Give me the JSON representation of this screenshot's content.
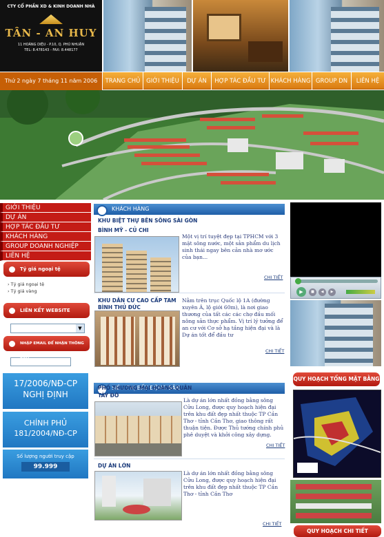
{
  "header": {
    "company_line": "CTY CỔ PHẦN XD & KINH DOANH NHÀ",
    "brand": "TÂN - AN HUY",
    "address": "11 HOÀNG DIỆU - P.10, Q. PHÚ NHUẬN",
    "phone": "TEL: 8.478143 - FAX: 8.448177"
  },
  "nav": {
    "date": "Thứ 2 ngày 7 tháng 11 năm 2006",
    "items": [
      "TRANG CHỦ",
      "GIỚI THIỆU",
      "DỰ ÁN",
      "HỢP TÁC ĐẦU TƯ",
      "KHÁCH HÀNG",
      "GROUP DN",
      "LIÊN HỆ"
    ]
  },
  "left": {
    "menu": [
      "GIỚI THIỆU",
      "DỰ ÁN",
      "HỢP TÁC ĐẦU TƯ",
      "KHÁCH HÀNG",
      "GROUP DOANH NGHIỆP",
      "LIÊN HỆ"
    ],
    "rate_title": "Tỷ giá ngoại tệ",
    "rate_links": [
      "Tỷ giá ngoại tệ",
      "Tỷ giá vàng"
    ],
    "link_title": "LIÊN KẾT WEBSITE",
    "email_title": "NHẬP EMAIL ĐỂ NHẬN THÔNG BÁO",
    "decree1": "17/2006/NĐ-CP",
    "decree1_sub": "NGHỊ ĐỊNH",
    "decree2a": "CHÍNH PHỦ",
    "decree2b": "181/2004/NĐ-CP",
    "visitors_label": "Số lượng người truy cập",
    "visitors": "99.999"
  },
  "center": {
    "section1": "KHÁCH HÀNG",
    "item1_title": "KHU BIỆT THỰ BÊN SÔNG SÀI GÒN BÌNH MỸ - CỦ CHI",
    "item1_text": "Một vị trí tuyệt đẹp tại TPHCM với 3 mặt sông nước, một sản phẩm du lịch sinh thái ngay bên cản nhà mơ ước của bạn...",
    "item2_title": "KHU DÂN CƯ CAO CẤP TAM BÌNH THỦ ĐỨC",
    "item2_text": "Nằm trên trục Quốc lộ 1A (đường xuyên Á, lộ giới 60m), là nơi giao thương của tất các các chợ đầu mối nông sản thực phẩm.  Vị trí lý tưởng để an cư với Cơ sở hạ tầng hiện đại và là Dự án tốt để đầu tư",
    "section2": "SIÊU THỊ BẤT ĐỘNG SẢN",
    "item3_title": "PHỐ THƯƠNG MẠI HOÀNG QUÂN TÂY ĐÔ",
    "item3_text": "Là dự án lớn nhất đồng bằng sông Cửu Long, được quy hoạch hiện đại trên khu đất đẹp nhất thuộc TP Cần Thơ - tỉnh Cần Thơ, giao thông rất thuận tiện. Được Thủ tướng chính phủ phê duyệt và khởi công xây dựng.",
    "item4_title": "DỰ ÁN LỚN",
    "item4_text": "Là dự án lớn nhất đồng bằng sông Cửu Long, được quy hoạch hiện đại trên khu đất đẹp nhất thuộc TP Cần Thơ - tỉnh Cần Thơ",
    "more": "CHI TIẾT"
  },
  "right": {
    "plan_title": "QUY HOẠCH TỔNG MẶT BẰNG",
    "detail_title": "QUY HOẠCH CHI TIẾT"
  }
}
